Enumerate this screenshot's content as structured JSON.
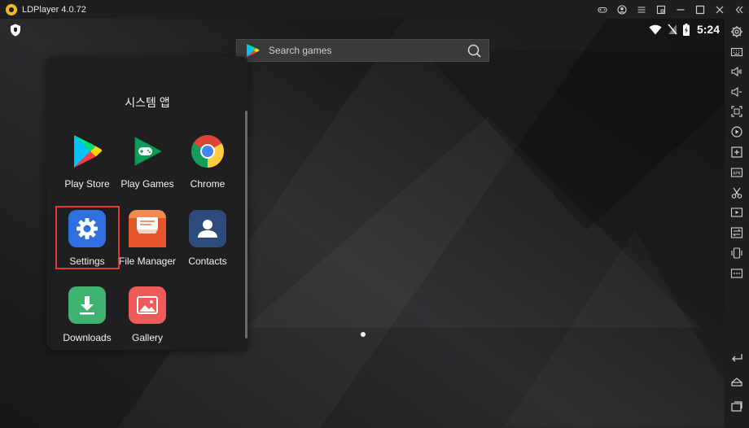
{
  "window": {
    "title": "LDPlayer 4.0.72"
  },
  "titlebar_icons": [
    "gamepad-icon",
    "user-icon",
    "menu-icon",
    "screenshot-icon",
    "minimize-icon",
    "maximize-icon",
    "close-icon",
    "collapse-icon"
  ],
  "statusbar": {
    "time": "5:24"
  },
  "search": {
    "label": "Search games"
  },
  "folder": {
    "title": "시스템 앱",
    "apps": [
      {
        "label": "Play Store",
        "icon": "play-store-icon"
      },
      {
        "label": "Play Games",
        "icon": "play-games-icon"
      },
      {
        "label": "Chrome",
        "icon": "chrome-icon"
      },
      {
        "label": "Settings",
        "icon": "settings-icon",
        "highlighted": true
      },
      {
        "label": "File Manager",
        "icon": "file-manager-icon"
      },
      {
        "label": "Contacts",
        "icon": "contacts-icon"
      },
      {
        "label": "Downloads",
        "icon": "downloads-icon"
      },
      {
        "label": "Gallery",
        "icon": "gallery-icon"
      }
    ]
  },
  "sidebar": {
    "icons": [
      "settings-icon",
      "keyboard-icon",
      "volume-up-icon",
      "volume-down-icon",
      "fullscreen-icon",
      "record-icon",
      "add-icon",
      "apk-icon",
      "scissors-icon",
      "video-icon",
      "sync-icon",
      "shake-icon",
      "more-icon",
      "back-icon",
      "home-icon",
      "recent-apps-icon"
    ]
  },
  "colors": {
    "highlight": "#e0393a",
    "settings_tile": "#2f6fe0",
    "file_manager_tile": "#ef6a3c",
    "contacts_tile": "#2e4a7a",
    "downloads_tile": "#3fb370",
    "gallery_tile": "#ef5a5a"
  }
}
